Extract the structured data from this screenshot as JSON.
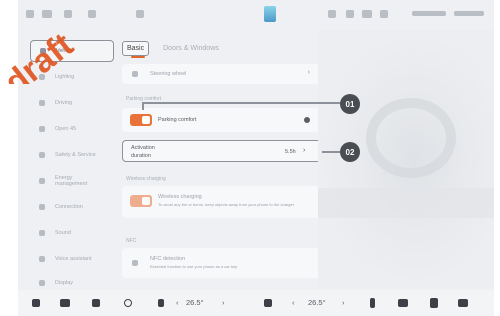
{
  "tabs": [
    {
      "label": "Basic"
    },
    {
      "label": "Doors & Windows"
    }
  ],
  "sidebar": {
    "items": [
      {
        "label": "Vehicle"
      },
      {
        "label": "Lighting"
      },
      {
        "label": "Driving"
      },
      {
        "label": "Open 45"
      },
      {
        "label": "Safety & Service"
      },
      {
        "label": "Energy management"
      },
      {
        "label": "Connection"
      },
      {
        "label": "Sound"
      },
      {
        "label": "Voice assistant"
      },
      {
        "label": "Display"
      }
    ]
  },
  "content": {
    "steering_label": "Steering wheel",
    "parking_section": "Parking comfort",
    "parking_toggle_label": "Parking comfort",
    "activation_label_line1": "Activation",
    "activation_label_line2": "duration",
    "activation_value": "5.5h",
    "wireless_section": "Wireless charging",
    "wireless_label": "Wireless charging",
    "wireless_desc": "To avoid any fire or burns, keep objects away from your phone to the charger",
    "nfc_section": "NFC",
    "nfc_label": "NFC detection",
    "nfc_desc": "Essential function to use your phone as a car key"
  },
  "callouts": {
    "first": "01",
    "second": "02"
  },
  "dock": {
    "temp_left": "26.5°",
    "temp_right": "26.5°"
  },
  "watermark": {
    "text": "draft",
    "color": "#e0551f"
  },
  "colors": {
    "accent": "#e9713a",
    "callout_badge": "#4a4d52"
  }
}
